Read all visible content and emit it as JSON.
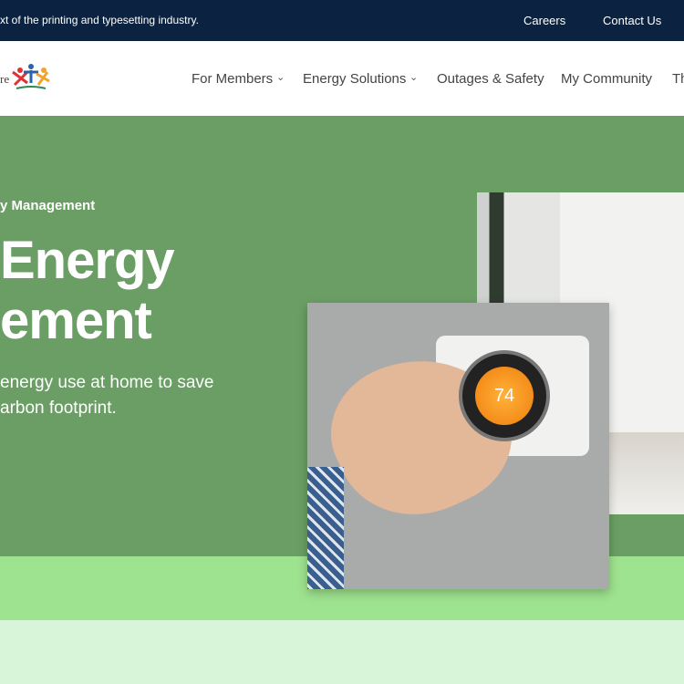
{
  "topbar": {
    "message": "xt of the printing and typesetting industry.",
    "links": [
      "Careers",
      "Contact Us"
    ]
  },
  "header": {
    "logo_text": "re",
    "nav": [
      "For Members",
      "Energy Solutions",
      "Outages & Safety",
      "My Community",
      "Th"
    ]
  },
  "hero": {
    "eyebrow": "y Management",
    "title_line1": "Energy",
    "title_line2": "ement",
    "subtitle_line1": "energy use at home to save",
    "subtitle_line2": "arbon footprint.",
    "thermostat_reading": "74"
  },
  "colors": {
    "topbar": "#0b2340",
    "hero": "#6b9e65",
    "band": "#9ee38f",
    "footer": "#d9f5d9"
  }
}
